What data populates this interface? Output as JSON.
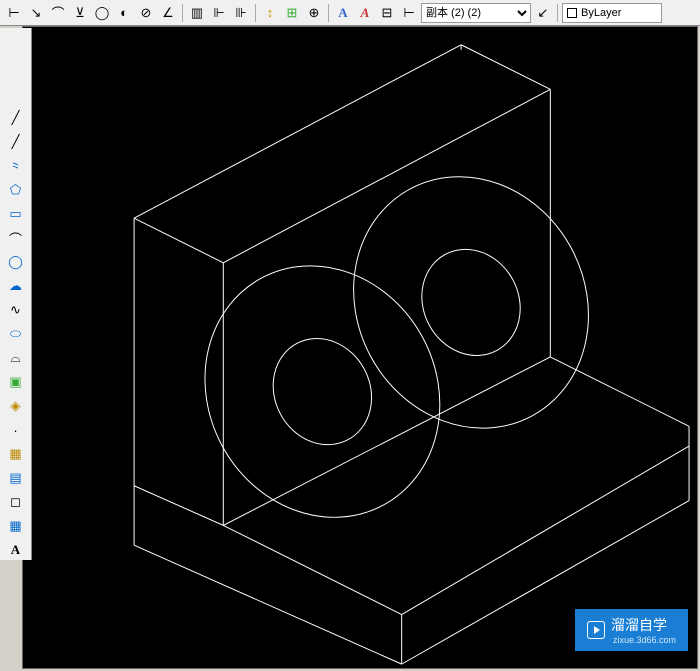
{
  "toolbar": {
    "dim_style_label": "副本 (2) (2)",
    "layer_label": "ByLayer"
  },
  "watermark": {
    "text": "溜溜自学",
    "url": "zixue.3d66.com"
  },
  "top_icons": [
    "linear-dim",
    "aligned-dim",
    "arc-dim",
    "ordinate-dim",
    "radius-dim",
    "jogged-dim",
    "diameter-dim",
    "angular-dim",
    "quick-dim",
    "baseline-dim",
    "continue-dim",
    "dim-space",
    "dim-break",
    "tolerance-dim",
    "center-mark",
    "inspect-dim",
    "jogged-linear",
    "dim-edit",
    "dim-text-edit",
    "dim-update"
  ],
  "left_icons": [
    "line",
    "construction-line",
    "polyline",
    "polygon",
    "rectangle",
    "arc",
    "circle",
    "revision-cloud",
    "spline",
    "ellipse",
    "ellipse-arc",
    "insert-block",
    "make-block",
    "point",
    "hatch",
    "gradient",
    "region",
    "table",
    "multiline-text"
  ]
}
